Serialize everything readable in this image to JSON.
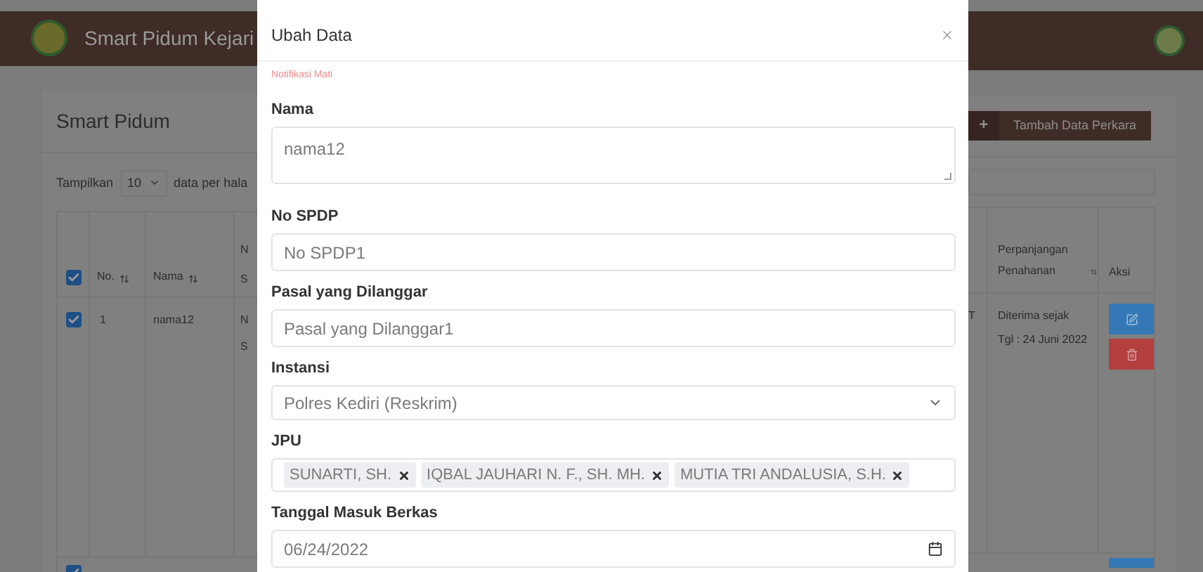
{
  "header": {
    "title": "Smart Pidum Kejari"
  },
  "page": {
    "title": "Smart Pidum",
    "add_button": {
      "icon": "+",
      "label": "Tambah Data Perkara"
    },
    "length": {
      "prefix": "Tampilkan",
      "value": "10",
      "suffix": "data per hala"
    }
  },
  "table": {
    "all_checked": true,
    "columns_left": [
      "No.",
      "Nama"
    ],
    "cut_column": [
      "N",
      "S"
    ],
    "columns_right": [
      "Perpanjangan Penahanan",
      "Aksi"
    ],
    "rows": [
      {
        "checked": true,
        "no": "1",
        "nama": "nama12",
        "cut": [
          "N",
          "S"
        ],
        "cut_right": "T",
        "perpanjangan": [
          "Diterima sejak",
          "Tgl : 24 Juni 2022"
        ]
      },
      {
        "checked": true
      }
    ]
  },
  "modal": {
    "title": "Ubah Data",
    "notification": "Notifikasi Mati",
    "fields": [
      {
        "kind": "textarea",
        "label": "Nama",
        "value": "nama12"
      },
      {
        "kind": "input",
        "label": "No SPDP",
        "value": "No SPDP1"
      },
      {
        "kind": "input",
        "label": "Pasal yang Dilanggar",
        "value": "Pasal yang Dilanggar1"
      },
      {
        "kind": "select",
        "label": "Instansi",
        "value": "Polres Kediri (Reskrim)"
      },
      {
        "kind": "tags",
        "label": "JPU",
        "tags": [
          "SUNARTI, SH.",
          "IQBAL JAUHARI N. F., SH. MH.",
          "MUTIA TRI ANDALUSIA, S.H."
        ]
      },
      {
        "kind": "date",
        "label": "Tanggal Masuk Berkas",
        "value": "06/24/2022"
      }
    ]
  }
}
